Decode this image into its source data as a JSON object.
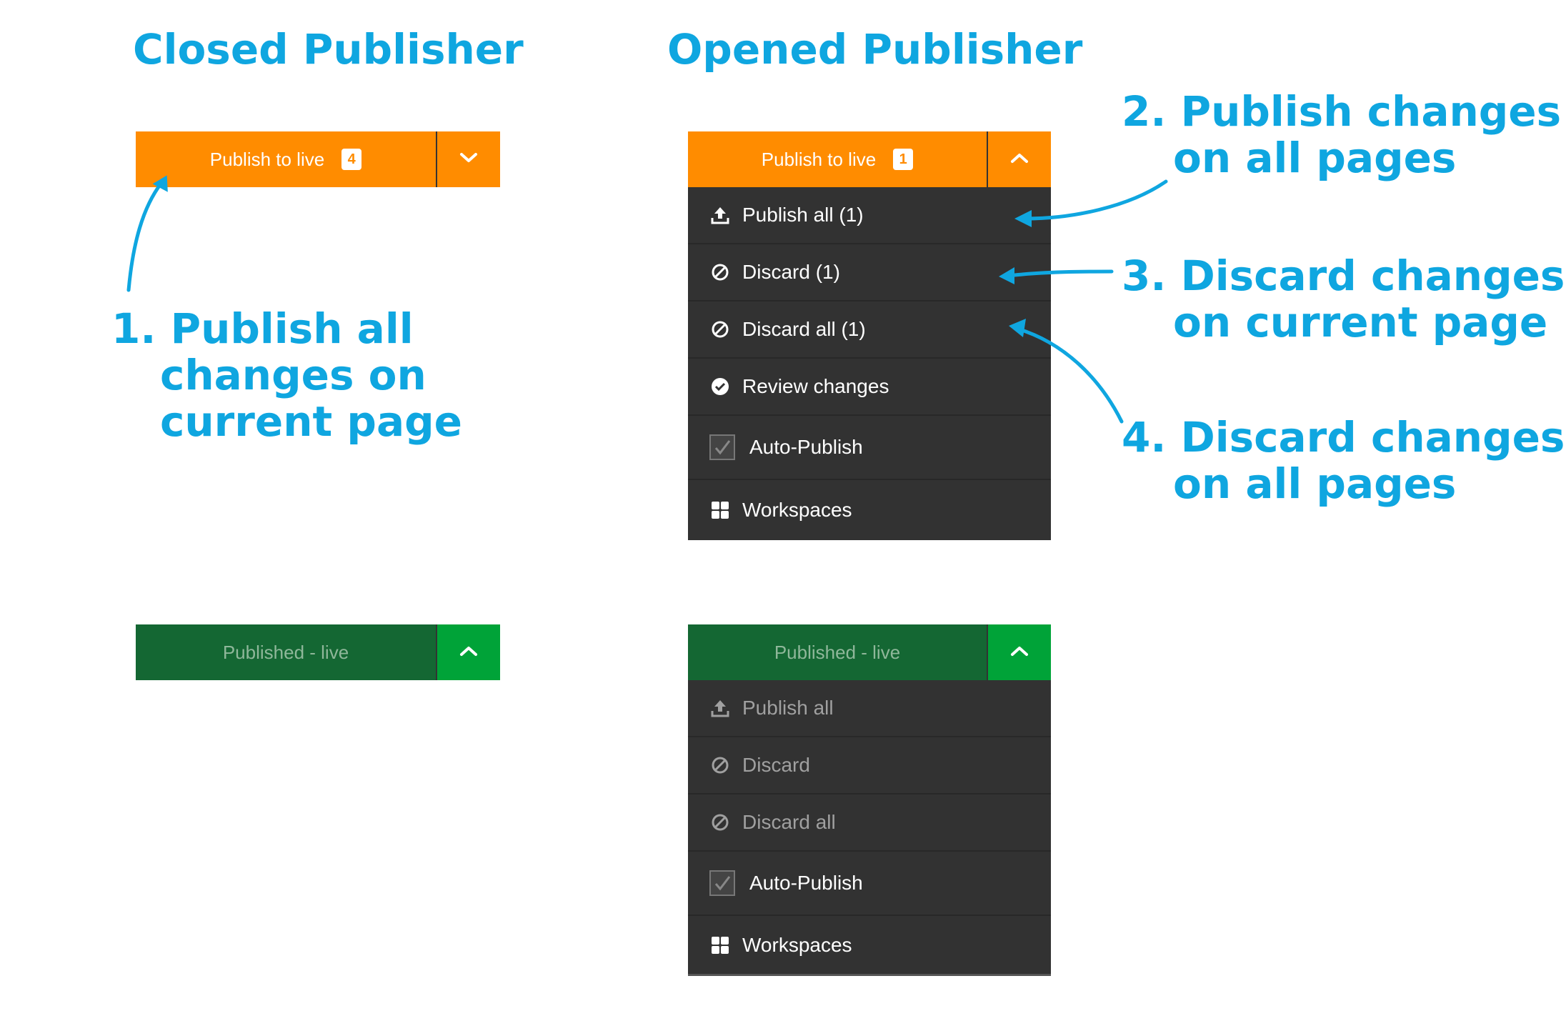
{
  "titles": {
    "closed": "Closed Publisher",
    "opened": "Opened Publisher"
  },
  "callouts": {
    "c1": {
      "num": "1.",
      "lines": [
        "Publish all",
        "changes on",
        "current page"
      ]
    },
    "c2": {
      "num": "2.",
      "lines": [
        "Publish changes",
        "on all pages"
      ]
    },
    "c3": {
      "num": "3.",
      "lines": [
        "Discard changes",
        "on current page"
      ]
    },
    "c4": {
      "num": "4.",
      "lines": [
        "Discard changes",
        "on all pages"
      ]
    }
  },
  "closed_unpublished": {
    "label": "Publish to live",
    "badge": "4"
  },
  "opened_unpublished": {
    "label": "Publish to live",
    "badge": "1",
    "menu": {
      "publish_all": "Publish all (1)",
      "discard": "Discard (1)",
      "discard_all": "Discard all (1)",
      "review": "Review changes",
      "auto_publish": "Auto-Publish",
      "workspaces": "Workspaces"
    }
  },
  "closed_published": {
    "label": "Published - live"
  },
  "opened_published": {
    "label": "Published - live",
    "menu": {
      "publish_all": "Publish all",
      "discard": "Discard",
      "discard_all": "Discard all",
      "auto_publish": "Auto-Publish",
      "workspaces": "Workspaces"
    }
  },
  "colors": {
    "accent": "#0fa6e0",
    "orange": "#ff8c00",
    "green_dark": "#146733",
    "green_bright": "#00a338",
    "menu_bg": "#323232"
  }
}
